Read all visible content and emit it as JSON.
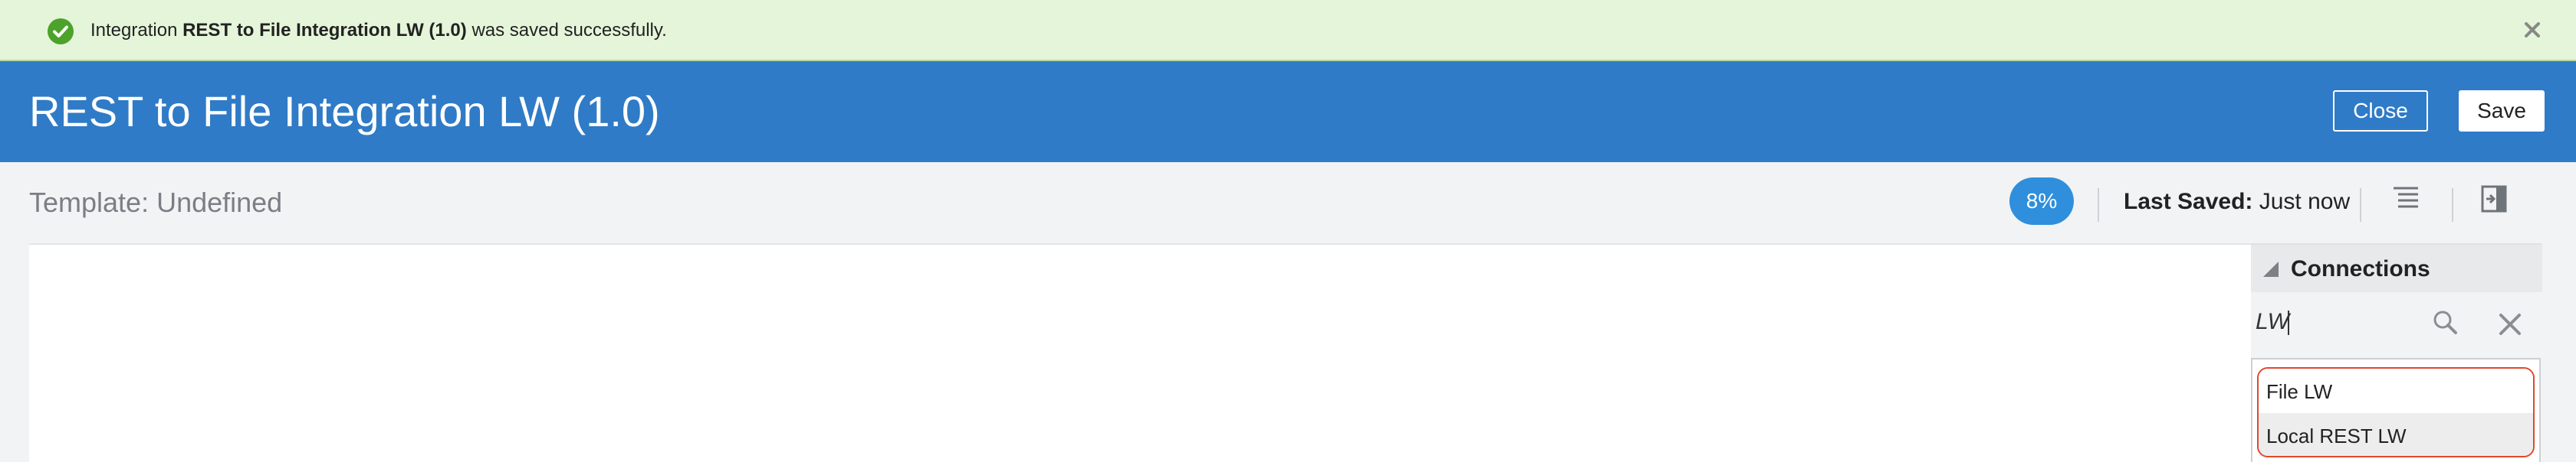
{
  "banner": {
    "prefix": "Integration ",
    "name": "REST to File Integration LW (1.0)",
    "suffix": " was saved successfully.",
    "icon": "check-circle-icon",
    "dismiss_icon": "close-icon",
    "color": "#e5f5d9"
  },
  "header": {
    "title": "REST to File Integration LW (1.0)",
    "close_label": "Close",
    "save_label": "Save",
    "color": "#2f7bc7"
  },
  "toolbar": {
    "template": "Template: Undefined",
    "progress": "8%",
    "last_saved_label": "Last Saved:",
    "last_saved_value": "Just now",
    "icons": [
      "list-view-icon",
      "toggle-panel-icon"
    ]
  },
  "connections": {
    "title": "Connections",
    "search_value": "LW",
    "options": [
      "File LW",
      "Local REST LW"
    ]
  }
}
